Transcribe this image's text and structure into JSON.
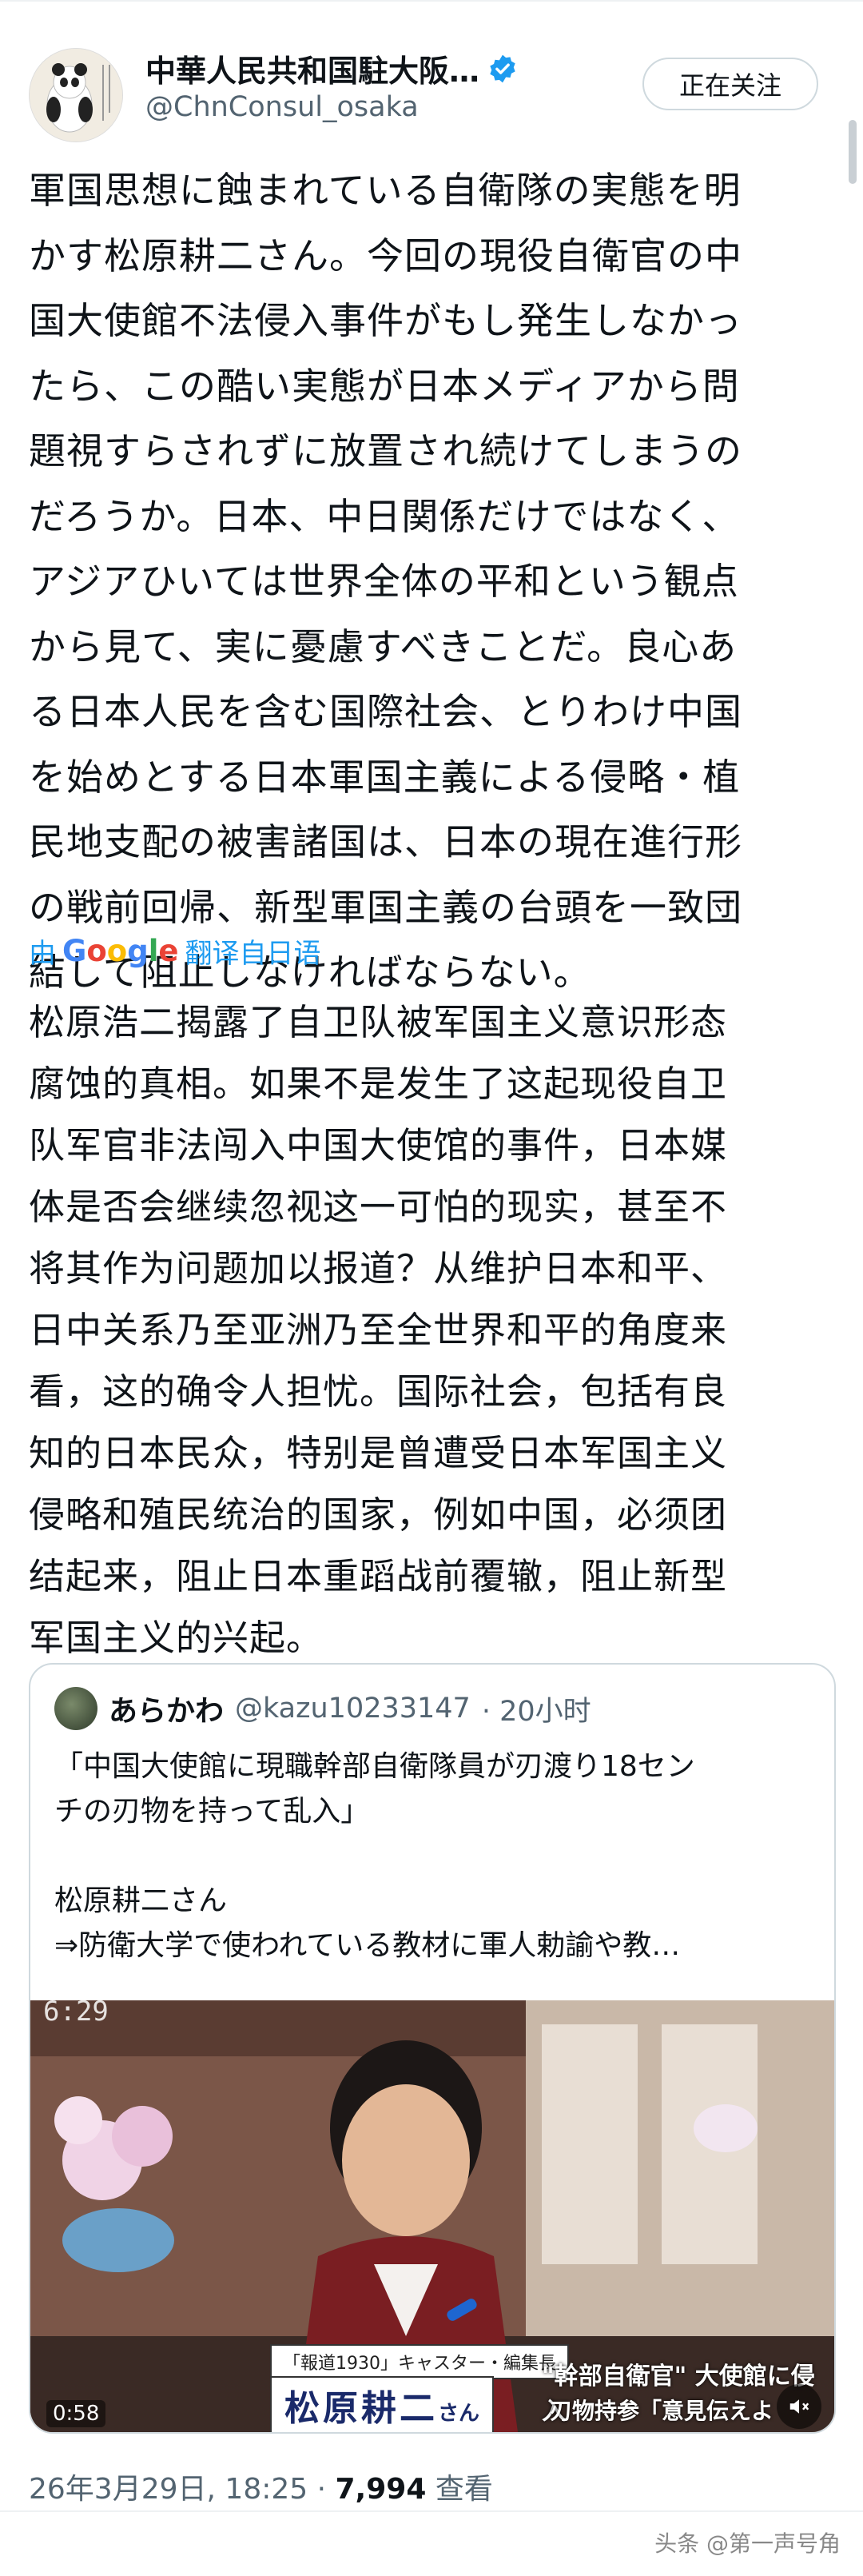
{
  "header": {
    "display_name": "中華人民共和国駐大阪…",
    "handle": "@ChnConsul_osaka",
    "follow_label": "正在关注",
    "avatar_icon": "panda-avatar-icon",
    "verified_icon": "verified-badge-icon",
    "verified_color": "#1d9bf0"
  },
  "tweet": {
    "lines": [
      "軍国思想に蝕まれている自衛隊の実態を明",
      "かす松原耕二さん。今回の現役自衛官の中",
      "国大使館不法侵入事件がもし発生しなかっ",
      "たら、この酷い実態が日本メディアから問",
      "題視すらされずに放置され続けてしまうの",
      "だろうか。日本、中日関係だけではなく、",
      "アジアひいては世界全体の平和という観点",
      "から見て、実に憂慮すべきことだ。良心あ",
      "る日本人民を含む国際社会、とりわけ中国",
      "を始めとする日本軍国主義による侵略・植",
      "民地支配の被害諸国は、日本の現在進行形",
      "の戦前回帰、新型軍国主義の台頭を一致団",
      "結して阻止しなければならない。"
    ]
  },
  "translation": {
    "prefix": "由",
    "google_word": "Google",
    "suffix": "翻译自日语",
    "lines": [
      "松原浩二揭露了自卫队被军国主义意识形态",
      "腐蚀的真相。如果不是发生了这起现役自卫",
      "队军官非法闯入中国大使馆的事件，日本媒",
      "体是否会继续忽视这一可怕的现实，甚至不",
      "将其作为问题加以报道？从维护日本和平、",
      "日中关系乃至亚洲乃至全世界和平的角度来",
      "看，这的确令人担忧。国际社会，包括有良",
      "知的日本民众，特别是曾遭受日本军国主义",
      "侵略和殖民统治的国家，例如中国，必须团",
      "结起来，阻止日本重蹈战前覆辙，阻止新型",
      "军国主义的兴起。"
    ]
  },
  "quote": {
    "name": "あらかわ",
    "handle": "@kazu10233147",
    "time": "· 20小时",
    "text_lines": [
      "「中国大使館に現職幹部自衛隊員が刃渡り18セン",
      "チの刃物を持って乱入」",
      "",
      "松原耕二さん",
      "⇒防衛大学で使われている教材に軍人勅諭や教…"
    ],
    "media": {
      "clock": "6:29",
      "program_tag": "「報道1930」キャスター・編集長",
      "person_name": "松原耕二",
      "honorific": "さん",
      "right_caption": "\"幹部自衛官\" 大使館に侵入",
      "right_caption2": "刃物持参「意見伝えよ",
      "duration": "0:58",
      "mute_icon": "mute-icon"
    }
  },
  "footer": {
    "datetime": "26年3月29日, 18:25 ·",
    "views_count": "7,994",
    "views_label": "查看"
  },
  "watermark": "头条 @第一声号角"
}
